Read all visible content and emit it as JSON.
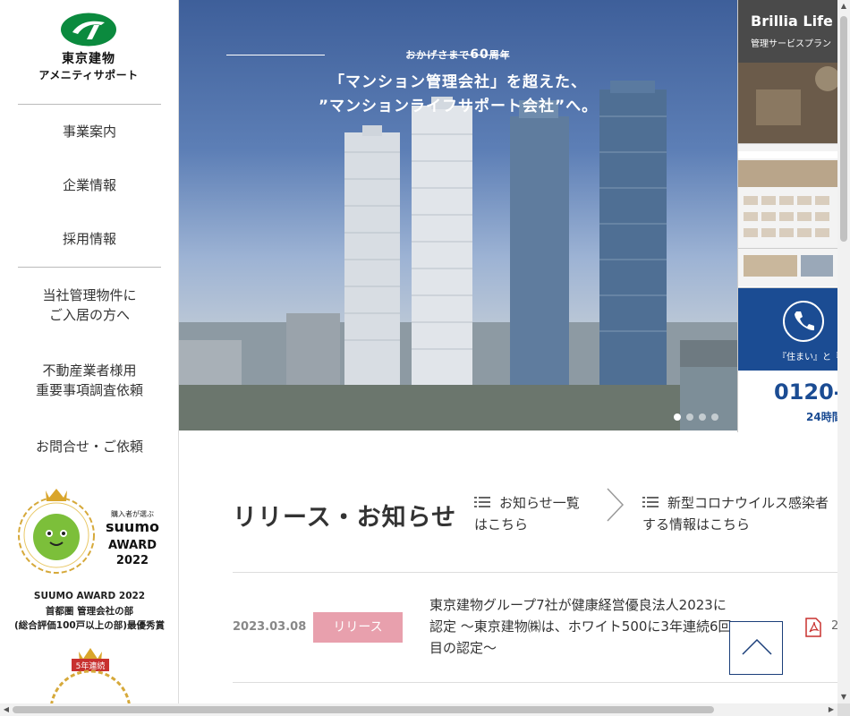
{
  "logo": {
    "line1": "東京建物",
    "line2": "アメニティサポート"
  },
  "nav": {
    "items": [
      {
        "label": "事業案内"
      },
      {
        "label": "企業情報"
      },
      {
        "label": "採用情報"
      }
    ],
    "resident_line1": "当社管理物件に",
    "resident_line2": "ご入居の方へ",
    "realtor_line1": "不動産業者様用",
    "realtor_line2": "重要事項調査依頼",
    "contact": "お問合せ・ご依頼"
  },
  "award": {
    "badge_top": "購入者が選ぶ",
    "badge_brand": "suumo",
    "badge_word": "AWARD",
    "badge_year": "2022",
    "caption_line1": "SUUMO AWARD 2022",
    "caption_line2": "首都圏 管理会社の部",
    "caption_line3": "(総合評価100戸以上の部)最優秀賞",
    "ribbon2": "5年連続"
  },
  "hero": {
    "eyebrow_prefix": "おかげさまで",
    "eyebrow_number": "60",
    "eyebrow_suffix": "周年",
    "headline_line1": "「マンション管理会社」を超えた、",
    "headline_line2": "”マンションライフサポート会社”へ。",
    "slides": [
      {
        "active": true
      },
      {
        "active": false
      },
      {
        "active": false
      },
      {
        "active": false
      }
    ]
  },
  "banners": {
    "b1_title": "Brillia Life",
    "b1_sub": "管理サービスプラン",
    "b3_tag": "『住まい』と『",
    "b3_phone": "0120-",
    "b3_hours": "24時間"
  },
  "news": {
    "title": "リリース・お知らせ",
    "link1_line1": "お知らせ一覧",
    "link1_line2": "はこちら",
    "link2_line1": "新型コロナウイルス感染者",
    "link2_line2": "する情報はこちら",
    "items": [
      {
        "date": "2023.03.08",
        "category": "リリース",
        "line1": "東京建物グループ7社が健康経営優良法人2023に",
        "line2": "認定 ～東京建物㈱は、ホワイト500に3年連続6回",
        "line3": "目の認定～",
        "pdf_tail": "2"
      }
    ]
  },
  "colors": {
    "brand_green": "#0b8a3e",
    "brand_navy": "#1b3f7a",
    "badge_pink": "#e8a0ad"
  }
}
